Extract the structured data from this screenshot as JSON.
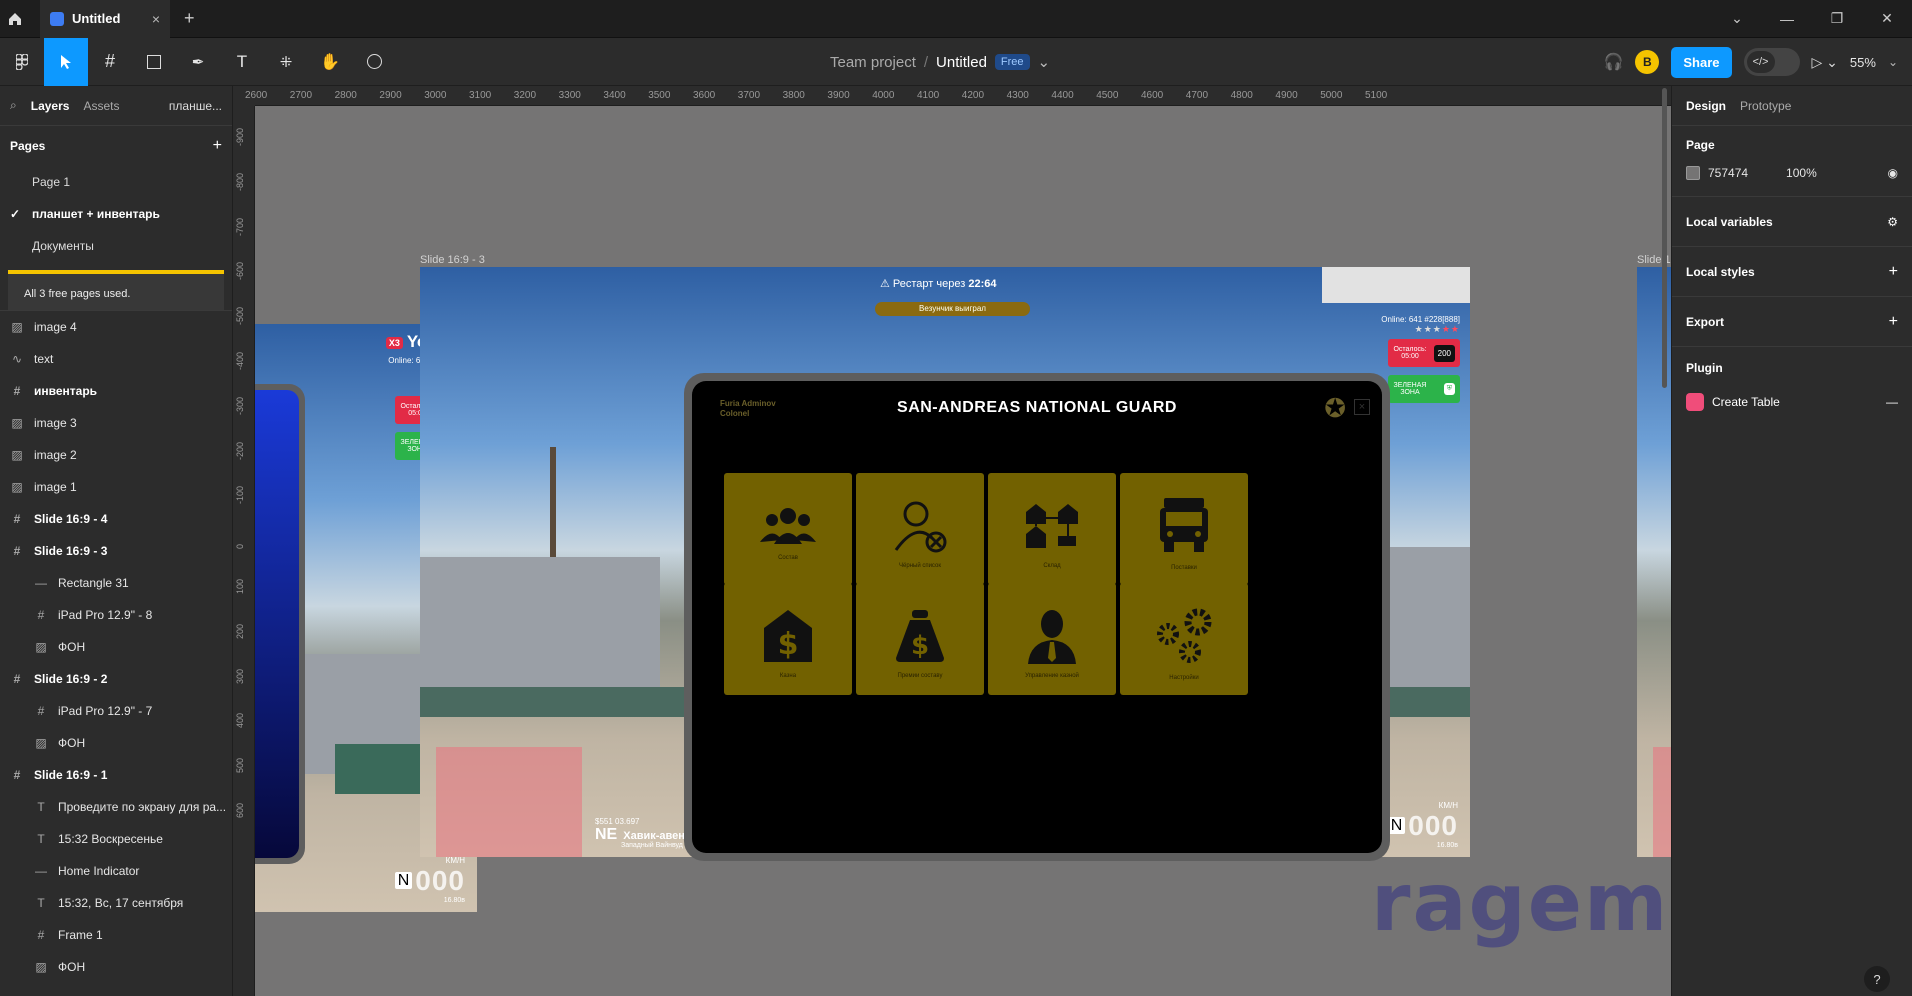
{
  "titlebar": {
    "tab_title": "Untitled",
    "close_glyph": "×",
    "add_glyph": "+"
  },
  "toolbar": {
    "team": "Team project",
    "file": "Untitled",
    "plan_badge": "Free",
    "share_label": "Share",
    "avatar_initial": "B",
    "zoom": "55%"
  },
  "left": {
    "tabs": {
      "layers": "Layers",
      "assets": "Assets",
      "page_switch": "планше..."
    },
    "pages_title": "Pages",
    "pages": [
      "Page 1",
      "планшет + инвентарь",
      "Документы"
    ],
    "upgrade_text": "All 3 free pages used.",
    "layers": [
      {
        "icon": "image",
        "name": "image 4",
        "child": false,
        "bold": false
      },
      {
        "icon": "vector",
        "name": "text",
        "child": false,
        "bold": false
      },
      {
        "icon": "frame",
        "name": "инвентарь",
        "child": false,
        "bold": true
      },
      {
        "icon": "image",
        "name": "image 3",
        "child": false,
        "bold": false
      },
      {
        "icon": "image",
        "name": "image 2",
        "child": false,
        "bold": false
      },
      {
        "icon": "image",
        "name": "image 1",
        "child": false,
        "bold": false
      },
      {
        "icon": "frame",
        "name": "Slide 16:9 - 4",
        "child": false,
        "bold": true
      },
      {
        "icon": "frame",
        "name": "Slide 16:9 - 3",
        "child": false,
        "bold": true
      },
      {
        "icon": "rect",
        "name": "Rectangle 31",
        "child": true,
        "bold": false
      },
      {
        "icon": "frame",
        "name": "iPad Pro 12.9\" - 8",
        "child": true,
        "bold": false
      },
      {
        "icon": "image",
        "name": "ФОН",
        "child": true,
        "bold": false
      },
      {
        "icon": "frame",
        "name": "Slide 16:9 - 2",
        "child": false,
        "bold": true
      },
      {
        "icon": "frame",
        "name": "iPad Pro 12.9\" - 7",
        "child": true,
        "bold": false
      },
      {
        "icon": "image",
        "name": "ФОН",
        "child": true,
        "bold": false
      },
      {
        "icon": "frame",
        "name": "Slide 16:9 - 1",
        "child": false,
        "bold": true
      },
      {
        "icon": "text",
        "name": "Проведите по экрану для ра...",
        "child": true,
        "bold": false
      },
      {
        "icon": "text",
        "name": "15:32 Воскресенье",
        "child": true,
        "bold": false
      },
      {
        "icon": "rect",
        "name": "Home Indicator",
        "child": true,
        "bold": false
      },
      {
        "icon": "text",
        "name": "15:32, Вс, 17 сентября",
        "child": true,
        "bold": false
      },
      {
        "icon": "frame",
        "name": "Frame 1",
        "child": true,
        "bold": false
      },
      {
        "icon": "image",
        "name": "ФОН",
        "child": true,
        "bold": false
      }
    ]
  },
  "rulers": {
    "top": [
      "2600",
      "2700",
      "2800",
      "2900",
      "3000",
      "3100",
      "3200",
      "3300",
      "3400",
      "3500",
      "3600",
      "3700",
      "3800",
      "3900",
      "4000",
      "4100",
      "4200",
      "4300",
      "4400",
      "4500",
      "4600",
      "4700",
      "4800",
      "4900",
      "5000",
      "5100"
    ],
    "left": [
      "-900",
      "-800",
      "-700",
      "-600",
      "-500",
      "-400",
      "-300",
      "-200",
      "-100",
      "0",
      "100",
      "200",
      "300",
      "400",
      "500",
      "600"
    ]
  },
  "canvas": {
    "slide_label_main": "Slide 16:9 - 3",
    "slide_label_right": "Slide 1",
    "restart_text": "Рестарт через",
    "restart_time": "22:64",
    "event_text": "Везунчик выиграл",
    "hud": {
      "logo": "Yoonex",
      "logo_badge": "X3",
      "online": "Online: 641  #228[888]",
      "timer_label": "Осталось: 05:00",
      "timer_value": "200",
      "zone_label": "ЗЕЛЕНАЯ ЗОНА",
      "speed_unit": "КМ/Н",
      "speed_gear": "N",
      "speed_value": "000",
      "fuel": "16.80в"
    },
    "road": {
      "dir": "NE",
      "street": "Хавик-авеню",
      "district": "Западный Вайнвуд",
      "cash": "$551 03.697"
    },
    "tablet": {
      "user_name": "Furia Adminov",
      "user_rank": "Colonel",
      "title": "SAN-ANDREAS NATIONAL GUARD",
      "close": "×",
      "tiles": [
        {
          "icon": "group-icon",
          "label": "Состав"
        },
        {
          "icon": "blacklist-user-icon",
          "label": "Чёрный список"
        },
        {
          "icon": "warehouse-icon",
          "label": "Склад"
        },
        {
          "icon": "truck-icon",
          "label": "Поставки"
        },
        {
          "icon": "bank-icon",
          "label": "Казна"
        },
        {
          "icon": "money-bag-icon",
          "label": "Премии составу"
        },
        {
          "icon": "manager-icon",
          "label": "Управление казной"
        },
        {
          "icon": "gears-icon",
          "label": "Настройки"
        }
      ]
    },
    "watermark": "ragemp.pro"
  },
  "right": {
    "tabs": {
      "design": "Design",
      "prototype": "Prototype"
    },
    "page_title": "Page",
    "page_color": "757474",
    "page_opacity": "100%",
    "sections": [
      "Local variables",
      "Local styles",
      "Export"
    ],
    "plugin_title": "Plugin",
    "plugin_name": "Create Table",
    "help": "?"
  },
  "colors": {
    "accent": "#0d99ff",
    "canvas": "#757474",
    "tile": "#726100",
    "hud_red": "#e22b46",
    "hud_green": "#2cb34a"
  }
}
